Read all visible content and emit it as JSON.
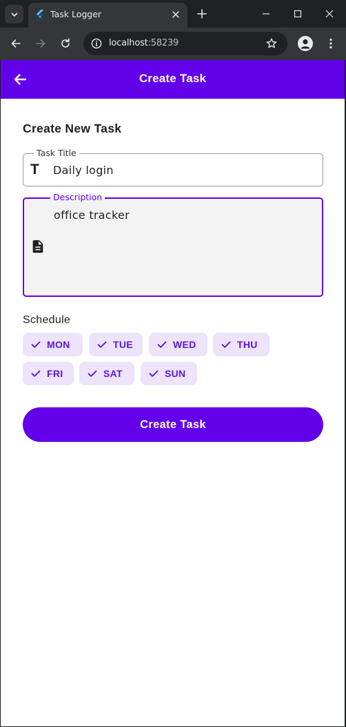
{
  "browser": {
    "tab_title": "Task Logger",
    "url_host": "localhost",
    "url_port": ":58239"
  },
  "appbar": {
    "title": "Create Task"
  },
  "form": {
    "heading": "Create New Task",
    "title_field": {
      "label": "Task Title",
      "icon_glyph": "T",
      "value": "Daily login"
    },
    "description_field": {
      "label": "Description",
      "value": "office tracker"
    },
    "schedule": {
      "label": "Schedule",
      "days": [
        {
          "label": "MON",
          "selected": true
        },
        {
          "label": "TUE",
          "selected": true
        },
        {
          "label": "WED",
          "selected": true
        },
        {
          "label": "THU",
          "selected": true
        },
        {
          "label": "FRI",
          "selected": true
        },
        {
          "label": "SAT",
          "selected": true
        },
        {
          "label": "SUN",
          "selected": true
        }
      ]
    },
    "submit_label": "Create Task"
  },
  "colors": {
    "primary": "#6200ea",
    "chip_background": "#ede3fb",
    "chip_text": "#5a16d6"
  },
  "icons": {
    "back": "arrow-back-icon",
    "title": "title-text-icon",
    "description": "description-document-icon",
    "check": "check-icon"
  }
}
